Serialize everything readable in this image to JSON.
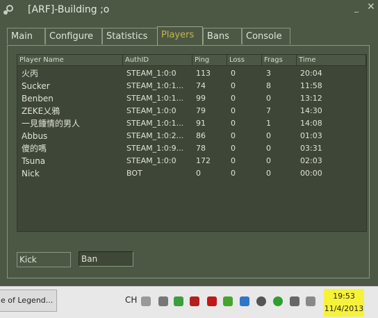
{
  "window": {
    "title": "[ARF]-Building ;o",
    "min_label": "_",
    "close_label": "✕"
  },
  "tabs": [
    "Main",
    "Configure",
    "Statistics",
    "Players",
    "Bans",
    "Console"
  ],
  "active_tab": "Players",
  "table": {
    "headers": [
      "Player Name",
      "AuthID",
      "Ping",
      "Loss",
      "Frags",
      "Time"
    ],
    "rows": [
      [
        "火丙",
        "STEAM_1:0:0",
        "113",
        "0",
        "3",
        "20:04"
      ],
      [
        "Sucker",
        "STEAM_1:0:1...",
        "74",
        "0",
        "8",
        "11:58"
      ],
      [
        "Benben",
        "STEAM_1:0:1...",
        "99",
        "0",
        "0",
        "13:12"
      ],
      [
        "ZEKE乂鴉",
        "STEAM_1:0:0",
        "79",
        "0",
        "7",
        "14:30"
      ],
      [
        "一見鍾情的男人",
        "STEAM_1:0:1...",
        "91",
        "0",
        "1",
        "14:08"
      ],
      [
        "Abbus",
        "STEAM_1:0:2...",
        "86",
        "0",
        "0",
        "01:03"
      ],
      [
        "傻的嗎",
        "STEAM_1:0:9...",
        "78",
        "0",
        "0",
        "03:31"
      ],
      [
        "Tsuna",
        "STEAM_1:0:0",
        "172",
        "0",
        "0",
        "02:03"
      ],
      [
        "Nick",
        "BOT",
        "0",
        "0",
        "0",
        "00:00"
      ]
    ]
  },
  "buttons": {
    "kick": "Kick",
    "ban": "Ban"
  },
  "taskbar": {
    "task_label": "e of Legend...",
    "language": "CH",
    "time": "19:53",
    "date": "11/4/2013"
  }
}
